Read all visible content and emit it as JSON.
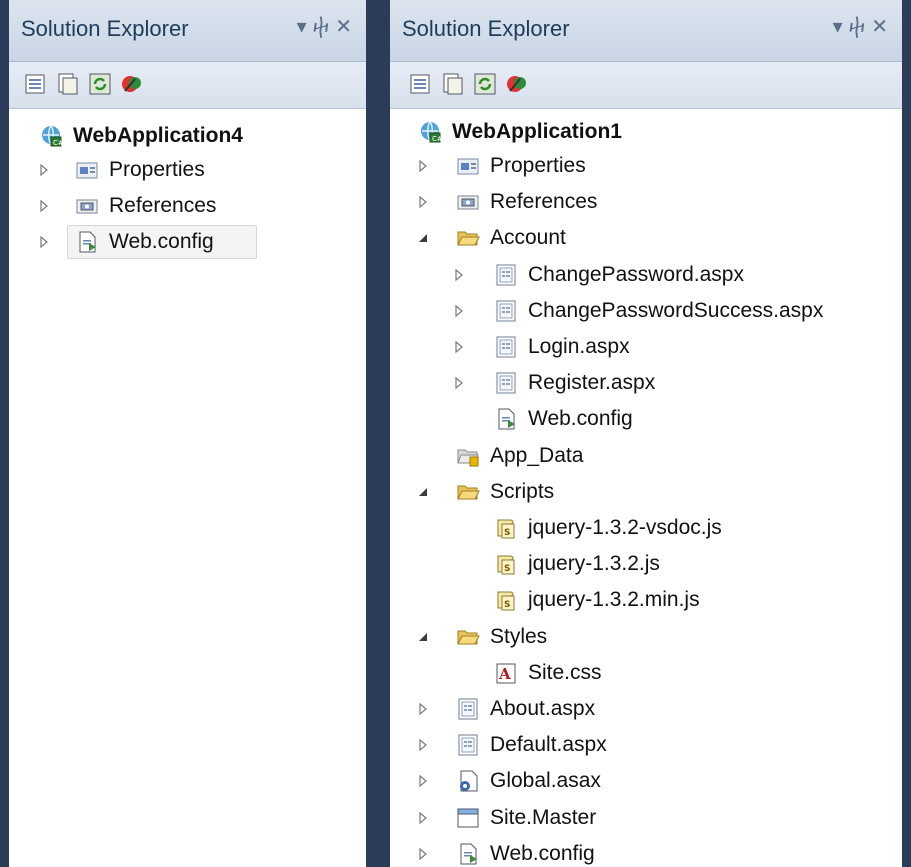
{
  "left_panel": {
    "title": "Solution Explorer",
    "toolbar_icons": [
      "properties-icon",
      "show-all-files-icon",
      "refresh-icon",
      "view-class-diagram-icon"
    ],
    "root": "WebApplication4",
    "items": [
      {
        "label": "Properties",
        "icon": "properties-folder-icon",
        "expander": "collapsed"
      },
      {
        "label": "References",
        "icon": "references-icon",
        "expander": "collapsed"
      },
      {
        "label": "Web.config",
        "icon": "config-file-icon",
        "expander": "collapsed",
        "selected": true
      }
    ]
  },
  "right_panel": {
    "title": "Solution Explorer",
    "toolbar_icons": [
      "properties-icon",
      "show-all-files-icon",
      "refresh-icon",
      "view-class-diagram-icon"
    ],
    "root": "WebApplication1",
    "items": [
      {
        "label": "Properties",
        "icon": "properties-folder-icon",
        "expander": "collapsed",
        "level": 1
      },
      {
        "label": "References",
        "icon": "references-icon",
        "expander": "collapsed",
        "level": 1
      },
      {
        "label": "Account",
        "icon": "folder-open-icon",
        "expander": "expanded",
        "level": 1
      },
      {
        "label": "ChangePassword.aspx",
        "icon": "aspx-file-icon",
        "expander": "collapsed",
        "level": 2
      },
      {
        "label": "ChangePasswordSuccess.aspx",
        "icon": "aspx-file-icon",
        "expander": "collapsed",
        "level": 2
      },
      {
        "label": "Login.aspx",
        "icon": "aspx-file-icon",
        "expander": "collapsed",
        "level": 2
      },
      {
        "label": "Register.aspx",
        "icon": "aspx-file-icon",
        "expander": "collapsed",
        "level": 2
      },
      {
        "label": "Web.config",
        "icon": "config-file-icon",
        "expander": "none",
        "level": 2
      },
      {
        "label": "App_Data",
        "icon": "app-data-folder-icon",
        "expander": "none",
        "level": 1
      },
      {
        "label": "Scripts",
        "icon": "folder-open-icon",
        "expander": "expanded",
        "level": 1
      },
      {
        "label": "jquery-1.3.2-vsdoc.js",
        "icon": "js-file-icon",
        "expander": "none",
        "level": 2
      },
      {
        "label": "jquery-1.3.2.js",
        "icon": "js-file-icon",
        "expander": "none",
        "level": 2
      },
      {
        "label": "jquery-1.3.2.min.js",
        "icon": "js-file-icon",
        "expander": "none",
        "level": 2
      },
      {
        "label": "Styles",
        "icon": "folder-open-icon",
        "expander": "expanded",
        "level": 1
      },
      {
        "label": "Site.css",
        "icon": "css-file-icon",
        "expander": "none",
        "level": 2
      },
      {
        "label": "About.aspx",
        "icon": "aspx-file-icon",
        "expander": "collapsed",
        "level": 1
      },
      {
        "label": "Default.aspx",
        "icon": "aspx-file-icon",
        "expander": "collapsed",
        "level": 1
      },
      {
        "label": "Global.asax",
        "icon": "global-asax-icon",
        "expander": "collapsed",
        "level": 1
      },
      {
        "label": "Site.Master",
        "icon": "master-page-icon",
        "expander": "collapsed",
        "level": 1
      },
      {
        "label": "Web.config",
        "icon": "config-file-icon",
        "expander": "collapsed",
        "level": 1
      }
    ]
  },
  "colors": {
    "frame": "#2b3c59",
    "title_text": "#1e3c5a",
    "folder": "#f2c94c"
  }
}
